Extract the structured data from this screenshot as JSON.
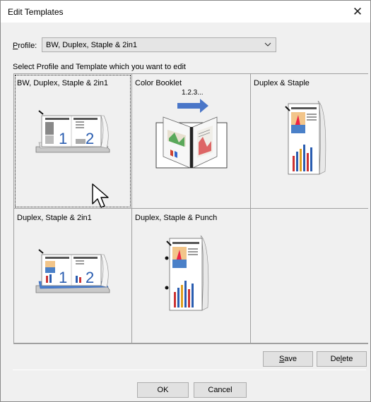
{
  "window": {
    "title": "Edit Templates",
    "close_glyph": "✕"
  },
  "profile": {
    "label_first": "P",
    "label_rest": "rofile:",
    "selected_value": "BW, Duplex, Staple & 2in1"
  },
  "instruction": "Select Profile and Template which you want to edit",
  "templates": [
    {
      "label": "BW, Duplex, Staple & 2in1",
      "icon": "two-in-one-stapled-booklet-icon",
      "selected": true,
      "page_numbers": [
        "1",
        "2"
      ]
    },
    {
      "label": "Color Booklet",
      "icon": "color-booklet-icon",
      "selected": false,
      "overlay_text": "1.2.3..."
    },
    {
      "label": "Duplex & Staple",
      "icon": "duplex-staple-document-icon",
      "selected": false
    },
    {
      "label": "Duplex, Staple & 2in1",
      "icon": "duplex-staple-2in1-icon",
      "selected": false,
      "page_numbers": [
        "1",
        "2"
      ]
    },
    {
      "label": "Duplex, Staple & Punch",
      "icon": "duplex-staple-punch-icon",
      "selected": false
    },
    {
      "label": "",
      "icon": "",
      "selected": false
    }
  ],
  "buttons": {
    "save_first": "S",
    "save_rest": "ave",
    "delete_first": "De",
    "delete_mid": "l",
    "delete_rest": "ete",
    "ok": "OK",
    "cancel": "Cancel"
  },
  "colors": {
    "dialog_bg": "#f0f0f0",
    "grid_line": "#a0a0a0",
    "accent_blue": "#2a5db0"
  }
}
